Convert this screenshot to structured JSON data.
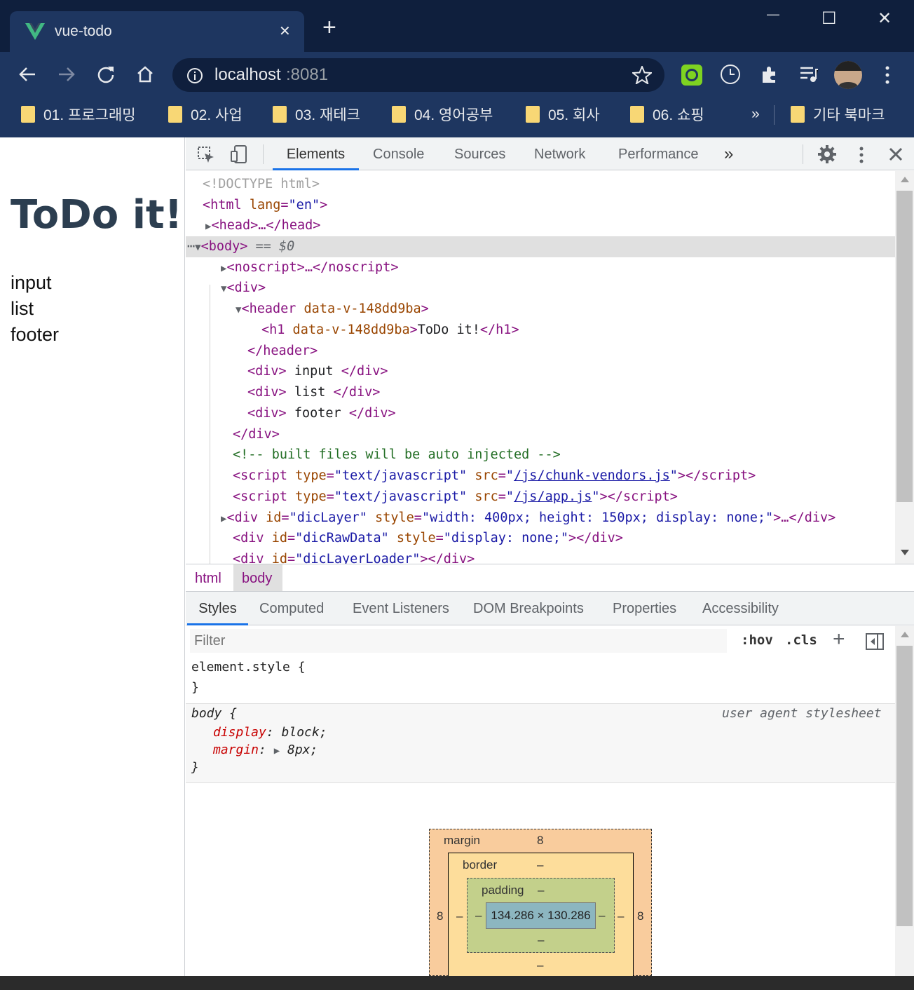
{
  "window": {
    "tab_title": "vue-todo",
    "tab_close": "✕",
    "new_tab": "+",
    "minimize": "—",
    "maximize": "☐",
    "close": "✕"
  },
  "toolbar": {
    "url_host": "localhost",
    "url_port": ":8081"
  },
  "bookmarks": {
    "items": [
      "01. 프로그래밍",
      "02. 사업",
      "03. 재테크",
      "04. 영어공부",
      "05. 회사",
      "06. 쇼핑"
    ],
    "overflow": "»",
    "other": "기타 북마크"
  },
  "page": {
    "title": "ToDo it!",
    "lines": [
      "input",
      "list",
      "footer"
    ]
  },
  "devtools": {
    "tabs": [
      "Elements",
      "Console",
      "Sources",
      "Network",
      "Performance"
    ],
    "more_tabs": "»",
    "dom": {
      "doctype": "<!DOCTYPE html>",
      "html_open_tag": "<html",
      "html_lang_attr": "lang",
      "html_lang_val": "\"en\"",
      "head": "<head>…</head>",
      "body_tag": "<body>",
      "body_eq": " == $0",
      "noscript": "<noscript>…</noscript>",
      "div_open": "<div>",
      "header_open": "<header",
      "header_attr": " data-v-148dd9ba",
      "h1_open": "<h1",
      "h1_attr": " data-v-148dd9ba",
      "h1_text": "ToDo it!",
      "h1_close": "</h1>",
      "header_close": "</header>",
      "div_input": "input",
      "div_list": "list",
      "div_footer": "footer",
      "div_close": "</div>",
      "comment": "<!-- built files will be auto injected -->",
      "script1_src": "/js/chunk-vendors.js",
      "script2_src": "/js/app.js",
      "script_type": "\"text/javascript\"",
      "dicLayer_style": "\"width: 400px; height: 150px; display: none;\"",
      "dicRawData_style": "\"display: none;\"",
      "dicLayerLoader": "\"dicLayerLoader\""
    },
    "breadcrumbs": [
      "html",
      "body"
    ],
    "style_tabs": [
      "Styles",
      "Computed",
      "Event Listeners",
      "DOM Breakpoints",
      "Properties",
      "Accessibility"
    ],
    "filter_placeholder": "Filter",
    "hov": ":hov",
    "cls": ".cls",
    "plus": "+",
    "element_style_selector": "element.style {",
    "close_brace": "}",
    "body_rule": {
      "selector": "body {",
      "source": "user agent stylesheet",
      "props": [
        {
          "name": "display",
          "value": "block;"
        },
        {
          "name": "margin",
          "value": "8px;"
        }
      ]
    },
    "box_model": {
      "margin_label": "margin",
      "margin_top": "8",
      "margin_left": "8",
      "margin_right": "8",
      "border_label": "border",
      "border_top": "–",
      "border_left": "–",
      "border_right": "–",
      "border_bottom": "–",
      "padding_label": "padding",
      "padding_top": "–",
      "padding_left": "–",
      "padding_right": "–",
      "padding_bottom": "–",
      "content": "134.286 × 130.286"
    }
  },
  "colors": {
    "chrome_dark": "#0f1f3d",
    "chrome_mid": "#1e3660",
    "accent": "#1a73e8",
    "vue_green": "#41b883",
    "page_title": "#2c3e50"
  }
}
